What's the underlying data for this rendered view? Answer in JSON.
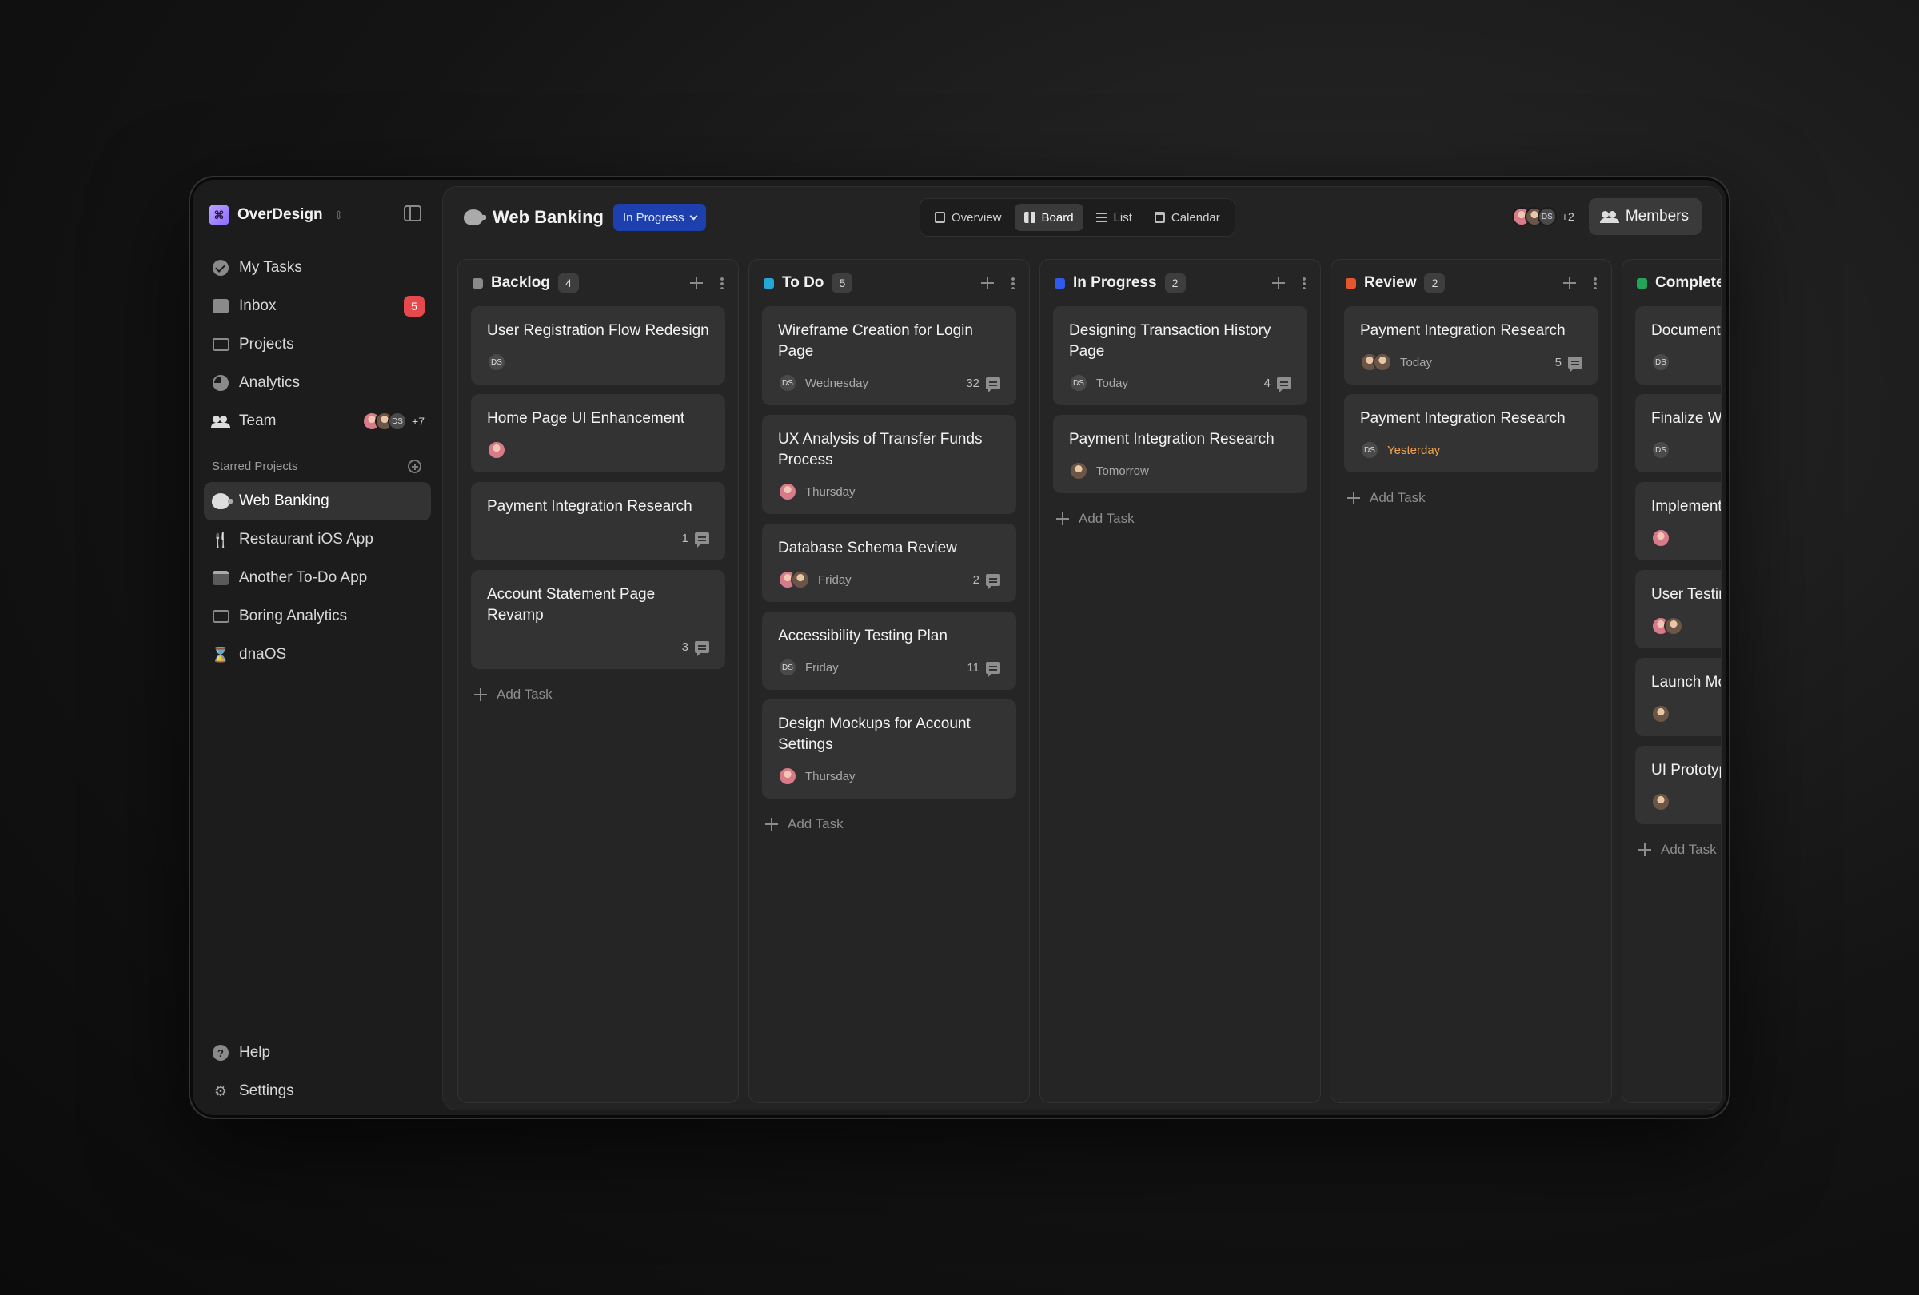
{
  "sidebar": {
    "workspace": "OverDesign",
    "nav": [
      {
        "label": "My Tasks",
        "icon": "check-circle-icon"
      },
      {
        "label": "Inbox",
        "icon": "inbox-icon",
        "badge": "5"
      },
      {
        "label": "Projects",
        "icon": "folder-icon"
      },
      {
        "label": "Analytics",
        "icon": "pie-chart-icon"
      },
      {
        "label": "Team",
        "icon": "team-icon",
        "avatars_more": "+7",
        "avatar_initials": "DS"
      }
    ],
    "starred_label": "Starred Projects",
    "starred": [
      {
        "label": "Web Banking",
        "icon": "piggy-bank-icon"
      },
      {
        "label": "Restaurant iOS App",
        "icon": "utensils-icon"
      },
      {
        "label": "Another To-Do App",
        "icon": "calendar-check-icon"
      },
      {
        "label": "Boring Analytics",
        "icon": "image-chart-icon"
      },
      {
        "label": "dnaOS",
        "icon": "dna-icon"
      }
    ],
    "bottom": [
      {
        "label": "Help",
        "icon": "help-icon"
      },
      {
        "label": "Settings",
        "icon": "settings-icon"
      }
    ]
  },
  "header": {
    "project": "Web Banking",
    "status": "In Progress",
    "views": [
      "Overview",
      "Board",
      "List",
      "Calendar"
    ],
    "active_view": "Board",
    "avatar_initials": "DS",
    "avatars_more": "+2",
    "members_label": "Members"
  },
  "colors": {
    "backlog": "#8a8a8a",
    "todo": "#22a7d8",
    "in_progress": "#2f5bea",
    "review": "#e4572e",
    "complete": "#22a559",
    "status_pill": "#1e40af",
    "badge": "#e5484d",
    "late": "#f0a24a"
  },
  "add_task_label": "Add Task",
  "columns": [
    {
      "title": "Backlog",
      "count": "4",
      "color": "#8a8a8a",
      "cards": [
        {
          "title": "User Registration Flow Redesign",
          "avatars": [
            "ds"
          ],
          "date": "",
          "comments": ""
        },
        {
          "title": "Home Page UI Enhancement",
          "avatars": [
            "a"
          ],
          "date": "",
          "comments": ""
        },
        {
          "title": "Payment Integration Research",
          "avatars": [],
          "date": "",
          "comments": "1"
        },
        {
          "title": "Account Statement Page Revamp",
          "avatars": [],
          "date": "",
          "comments": "3"
        }
      ]
    },
    {
      "title": "To Do",
      "count": "5",
      "color": "#22a7d8",
      "cards": [
        {
          "title": "Wireframe Creation for Login Page",
          "avatars": [
            "ds"
          ],
          "date": "Wednesday",
          "comments": "32"
        },
        {
          "title": "UX Analysis of Transfer Funds Process",
          "avatars": [
            "a"
          ],
          "date": "Thursday",
          "comments": ""
        },
        {
          "title": "Database Schema Review",
          "avatars": [
            "a",
            "b"
          ],
          "date": "Friday",
          "comments": "2"
        },
        {
          "title": "Accessibility Testing Plan",
          "avatars": [
            "ds"
          ],
          "date": "Friday",
          "comments": "11"
        },
        {
          "title": "Design Mockups for Account Settings",
          "avatars": [
            "a"
          ],
          "date": "Thursday",
          "comments": ""
        }
      ]
    },
    {
      "title": "In Progress",
      "count": "2",
      "color": "#2f5bea",
      "cards": [
        {
          "title": "Designing Transaction History Page",
          "avatars": [
            "ds"
          ],
          "date": "Today",
          "comments": "4"
        },
        {
          "title": "Payment Integration Research",
          "avatars": [
            "b"
          ],
          "date": "Tomorrow",
          "comments": ""
        }
      ]
    },
    {
      "title": "Review",
      "count": "2",
      "color": "#e4572e",
      "cards": [
        {
          "title": "Payment Integration Research",
          "avatars": [
            "b",
            "b"
          ],
          "date": "Today",
          "comments": "5"
        },
        {
          "title": "Payment Integration Research",
          "avatars": [
            "ds"
          ],
          "date": "Yesterday",
          "late": true,
          "comments": ""
        }
      ]
    },
    {
      "title": "Complete",
      "count": "",
      "color": "#22a559",
      "cards": [
        {
          "title": "Document",
          "avatars": [
            "ds"
          ],
          "date": "",
          "comments": ""
        },
        {
          "title": "Finalize Wi Dashboard",
          "avatars": [
            "ds"
          ],
          "date": "",
          "comments": ""
        },
        {
          "title": "Implement for Tablet",
          "avatars": [
            "a"
          ],
          "date": "",
          "comments": ""
        },
        {
          "title": "User Testin Compilatio",
          "avatars": [
            "a",
            "b"
          ],
          "date": "",
          "comments": ""
        },
        {
          "title": "Launch Mo",
          "avatars": [
            "b"
          ],
          "date": "",
          "comments": ""
        },
        {
          "title": "UI Prototyp",
          "avatars": [
            "b"
          ],
          "date": "",
          "comments": ""
        }
      ]
    }
  ]
}
